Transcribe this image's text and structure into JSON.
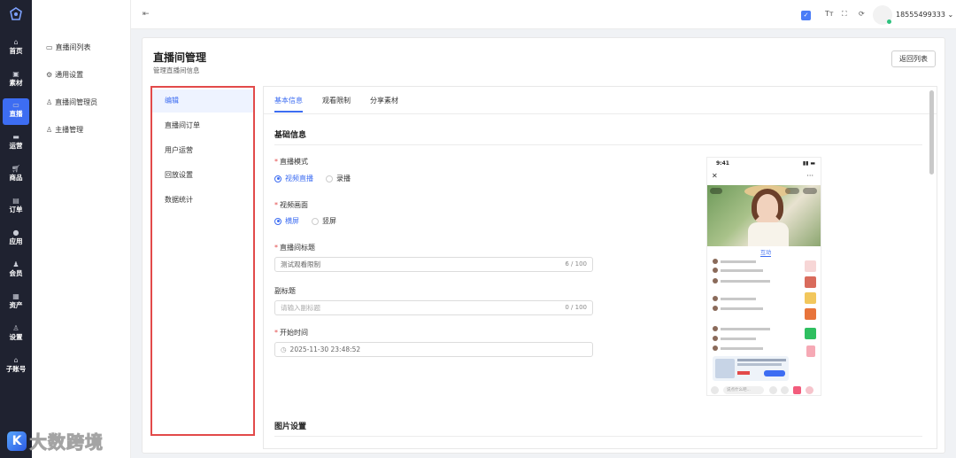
{
  "rail": {
    "items": [
      {
        "label": "首页",
        "icon": "home-icon"
      },
      {
        "label": "素材",
        "icon": "image-icon"
      },
      {
        "label": "直播",
        "icon": "video-icon"
      },
      {
        "label": "运营",
        "icon": "inbox-icon"
      },
      {
        "label": "商品",
        "icon": "cart-icon"
      },
      {
        "label": "订单",
        "icon": "document-icon"
      },
      {
        "label": "应用",
        "icon": "drop-icon"
      },
      {
        "label": "会员",
        "icon": "users-icon"
      },
      {
        "label": "资产",
        "icon": "wallet-icon"
      },
      {
        "label": "设置",
        "icon": "user-gear-icon"
      },
      {
        "label": "子账号",
        "icon": "home-icon"
      }
    ],
    "active_index": 2
  },
  "submenu": {
    "items": [
      {
        "label": "直播间列表",
        "icon": "video-icon"
      },
      {
        "label": "通用设置",
        "icon": "gear-icon"
      },
      {
        "label": "直播间管理员",
        "icon": "user-icon"
      },
      {
        "label": "主播管理",
        "icon": "user-icon"
      }
    ]
  },
  "topbar": {
    "phone": "18555499333",
    "avatar_status_color": "#2ec27e"
  },
  "page": {
    "title": "直播间管理",
    "subtitle": "管理直播间信息",
    "back_button": "返回列表"
  },
  "leftnav": {
    "items": [
      "编辑",
      "直播间订单",
      "用户运营",
      "回放设置",
      "数据统计"
    ],
    "active_index": 0
  },
  "tabs": {
    "items": [
      "基本信息",
      "观看限制",
      "分享素材"
    ],
    "active_index": 0
  },
  "form": {
    "section_title": "基础信息",
    "live_mode": {
      "label": "直播模式",
      "options": [
        "视频直播",
        "录播"
      ],
      "selected": "视频直播"
    },
    "video_frame": {
      "label": "视频画面",
      "options": [
        "横屏",
        "竖屏"
      ],
      "selected": "横屏"
    },
    "room_title": {
      "label": "直播间标题",
      "value": "测试观看限制",
      "counter": "6 / 100"
    },
    "subtitle_field": {
      "label": "副标题",
      "placeholder": "请输入副标题",
      "counter": "0 / 100"
    },
    "start_time": {
      "label": "开始时间",
      "value": "2025-11-30 23:48:52"
    },
    "image_section_title": "图片设置"
  },
  "preview": {
    "status_time": "9:41",
    "tab_label": "互动",
    "input_placeholder": "说点什么吧..."
  },
  "watermark": {
    "text": "大数跨境",
    "logo_letter": "K"
  },
  "colors": {
    "accent": "#3d6df2",
    "highlight_border": "#e24a4a",
    "rail_bg": "#1f2230"
  }
}
